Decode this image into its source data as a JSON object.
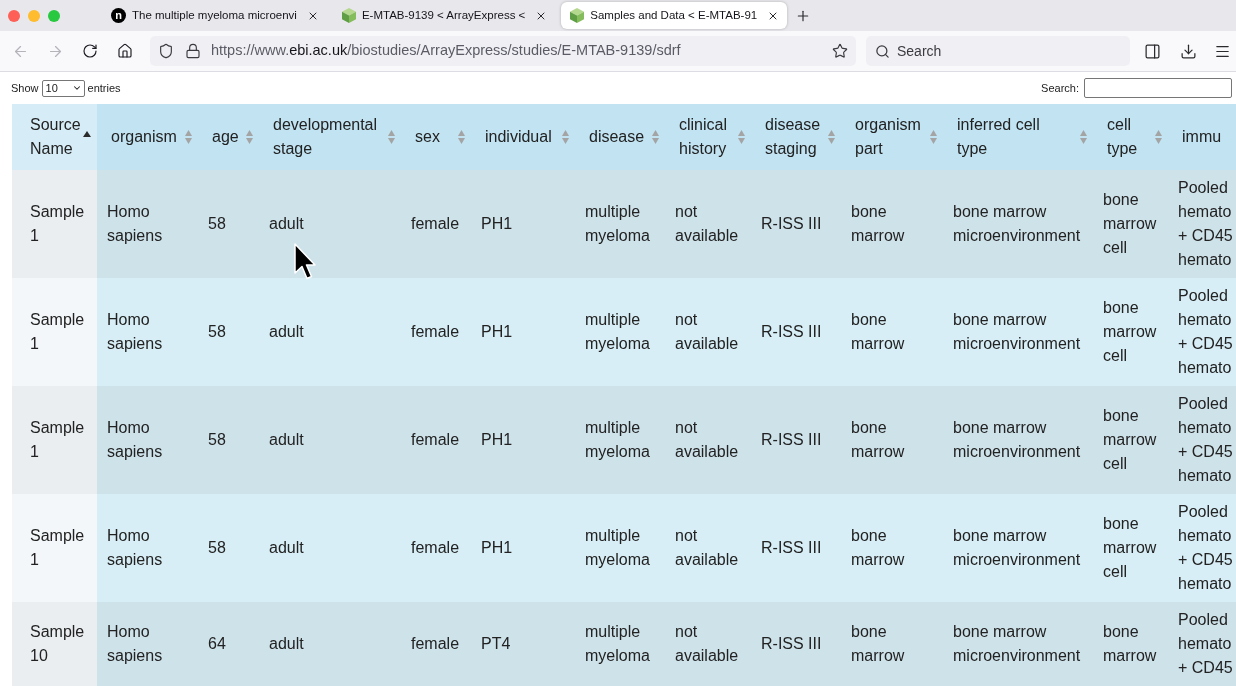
{
  "tabs": [
    {
      "title": "The multiple myeloma microenvi",
      "selected": false,
      "favicon": {
        "kind": "letter",
        "text": "n"
      }
    },
    {
      "title": "E-MTAB-9139 < ArrayExpress <",
      "selected": false,
      "favicon": {
        "kind": "cube"
      }
    },
    {
      "title": "Samples and Data < E-MTAB-91",
      "selected": true,
      "favicon": {
        "kind": "cube"
      }
    }
  ],
  "toolbar": {
    "back": {
      "disabled": true
    },
    "forward": {
      "disabled": true
    },
    "url": {
      "prefix": "https://www.",
      "domain": "ebi.ac.uk",
      "path": "/biostudies/ArrayExpress/studies/E-MTAB-9139/sdrf"
    },
    "search": {
      "placeholder": "Search"
    }
  },
  "page": {
    "length_menu": {
      "before": "Show",
      "value": "10",
      "after": "entries"
    },
    "filter": {
      "label": "Search:"
    },
    "table": {
      "columns": [
        {
          "label": "Source Name",
          "sorted": true
        },
        {
          "label": "organism",
          "sorted": false
        },
        {
          "label": "age",
          "sorted": false
        },
        {
          "label": "developmental stage",
          "sorted": false
        },
        {
          "label": "sex",
          "sorted": false
        },
        {
          "label": "individual",
          "sorted": false
        },
        {
          "label": "disease",
          "sorted": false
        },
        {
          "label": "clinical history",
          "sorted": false
        },
        {
          "label": "disease staging",
          "sorted": false
        },
        {
          "label": "organism part",
          "sorted": false
        },
        {
          "label": "inferred cell type",
          "sorted": false
        },
        {
          "label": "cell type",
          "sorted": false
        },
        {
          "label": "immu"
        }
      ],
      "rows": [
        [
          "Sample 1",
          "Homo sapiens",
          "58",
          "adult",
          "female",
          "PH1",
          "multiple myeloma",
          "not available",
          "R-ISS III",
          "bone marrow",
          "bone marrow microenvironment",
          "bone marrow cell",
          "Pooled hemato + CD45 hemato"
        ],
        [
          "Sample 1",
          "Homo sapiens",
          "58",
          "adult",
          "female",
          "PH1",
          "multiple myeloma",
          "not available",
          "R-ISS III",
          "bone marrow",
          "bone marrow microenvironment",
          "bone marrow cell",
          "Pooled hemato + CD45 hemato"
        ],
        [
          "Sample 1",
          "Homo sapiens",
          "58",
          "adult",
          "female",
          "PH1",
          "multiple myeloma",
          "not available",
          "R-ISS III",
          "bone marrow",
          "bone marrow microenvironment",
          "bone marrow cell",
          "Pooled hemato + CD45 hemato"
        ],
        [
          "Sample 1",
          "Homo sapiens",
          "58",
          "adult",
          "female",
          "PH1",
          "multiple myeloma",
          "not available",
          "R-ISS III",
          "bone marrow",
          "bone marrow microenvironment",
          "bone marrow cell",
          "Pooled hemato + CD45 hemato"
        ],
        [
          "Sample 10",
          "Homo sapiens",
          "64",
          "adult",
          "female",
          "PT4",
          "multiple myeloma",
          "not available",
          "R-ISS III",
          "bone marrow",
          "bone marrow microenvironment",
          "bone marrow",
          "Pooled hemato + CD45"
        ]
      ]
    }
  }
}
